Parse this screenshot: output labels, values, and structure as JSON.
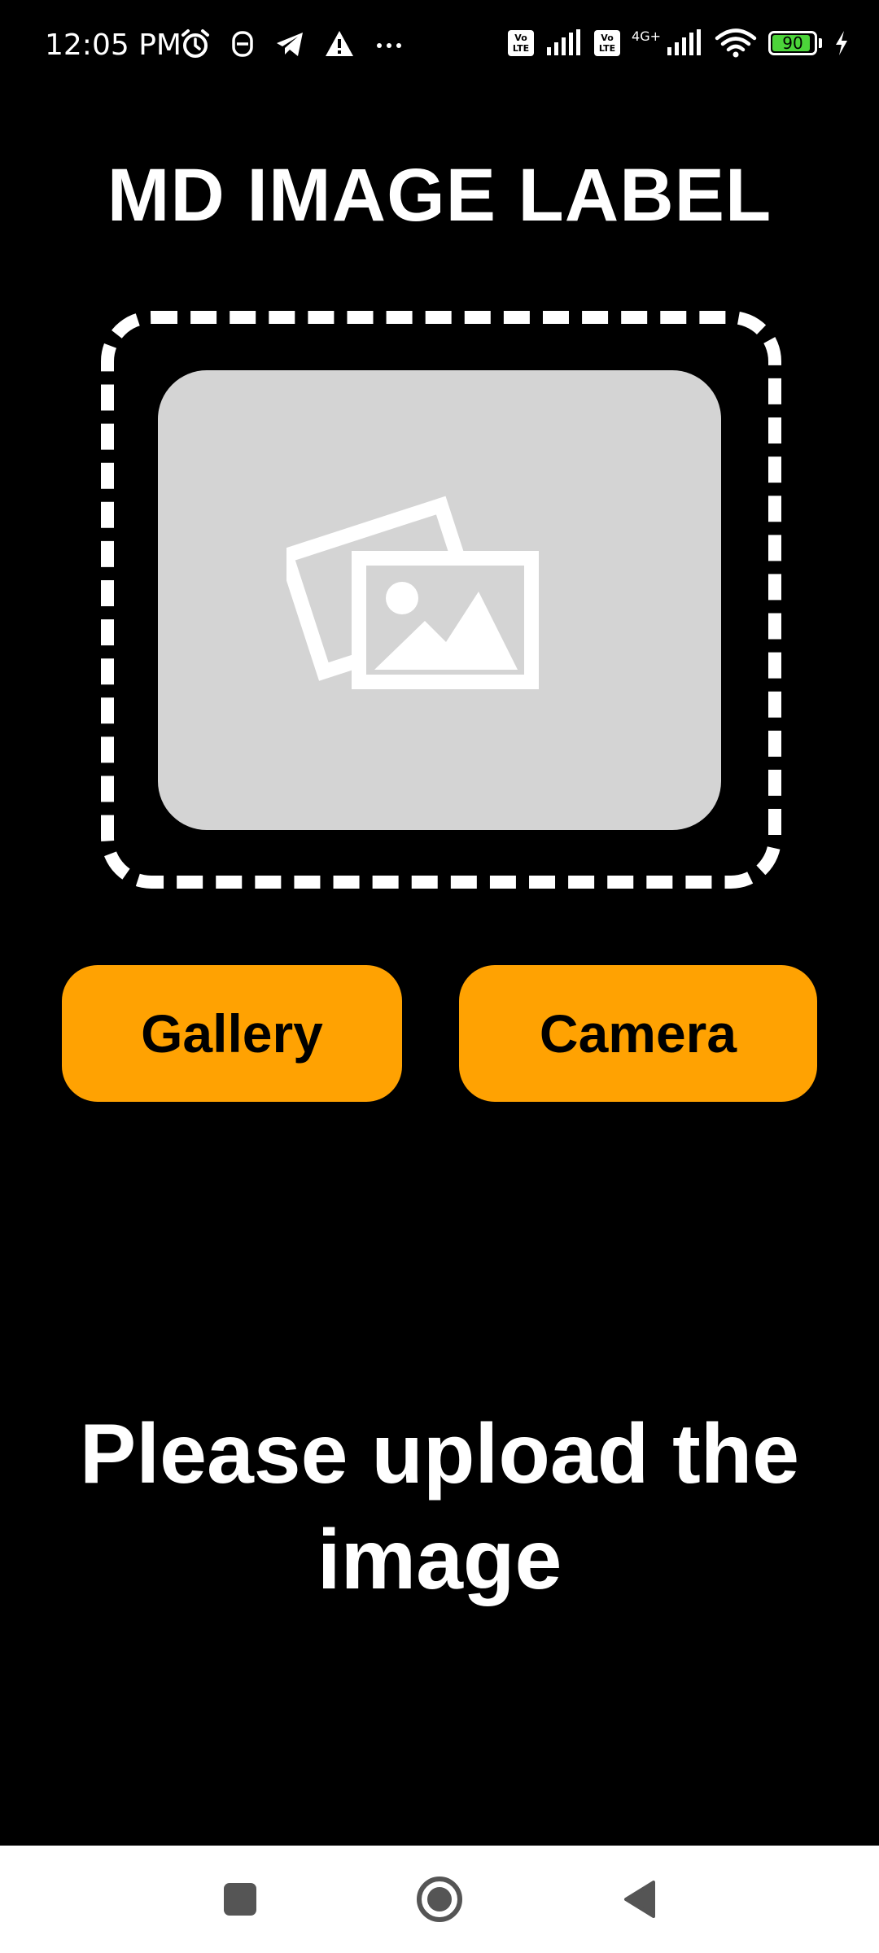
{
  "status_bar": {
    "time": "12:05 PM",
    "lte1": "Vo\nLTE",
    "lte2": "Vo\nLTE",
    "network_label": "4G+",
    "battery_level": "90",
    "battery_color": "#4cd43a"
  },
  "app": {
    "title": "MD IMAGE LABEL",
    "preview_icon": "image-placeholder-icon"
  },
  "buttons": {
    "gallery_label": "Gallery",
    "camera_label": "Camera",
    "accent_color": "#ffa202"
  },
  "message": {
    "text": "Please upload the image"
  },
  "nav_bar": {
    "recents_icon": "square-icon",
    "home_icon": "circle-icon",
    "back_icon": "triangle-back-icon"
  }
}
